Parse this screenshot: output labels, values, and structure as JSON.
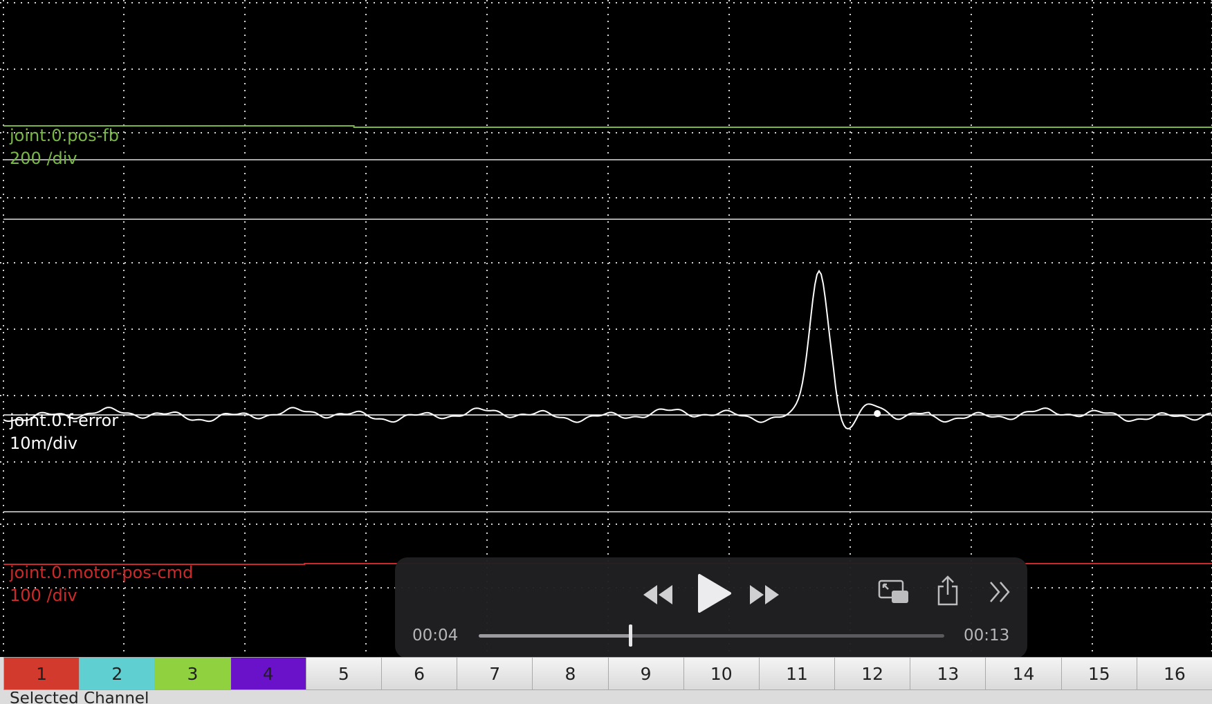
{
  "channels": [
    {
      "name": "joint.0.pos-fb",
      "scale": "200 /div",
      "color": "#7ab648"
    },
    {
      "name": "joint.0.f-error",
      "scale": "10m/div",
      "color": "#ffffff"
    },
    {
      "name": "joint.0.motor-pos-cmd",
      "scale": "100 /div",
      "color": "#cc2a2a"
    }
  ],
  "trace_shape": {
    "pos_fb_step_fraction": 0.29,
    "f_error_peak": {
      "time_fraction": 0.675,
      "amplitude_divs": 2.2
    },
    "f_error_ringing_divs": 0.45
  },
  "player": {
    "current_time": "00:04",
    "total_time": "00:13",
    "progress_fraction": 0.325,
    "icons": [
      "rewind-icon",
      "play-icon",
      "fast-forward-icon",
      "picture-in-picture-icon",
      "share-icon",
      "more-chevrons-icon"
    ]
  },
  "channel_buttons": [
    {
      "label": "1",
      "color": "#d23a2e"
    },
    {
      "label": "2",
      "color": "#5fcfd2"
    },
    {
      "label": "3",
      "color": "#8fd13f"
    },
    {
      "label": "4",
      "color": "#6a12c9"
    },
    {
      "label": "5",
      "color": ""
    },
    {
      "label": "6",
      "color": ""
    },
    {
      "label": "7",
      "color": ""
    },
    {
      "label": "8",
      "color": ""
    },
    {
      "label": "9",
      "color": ""
    },
    {
      "label": "10",
      "color": ""
    },
    {
      "label": "11",
      "color": ""
    },
    {
      "label": "12",
      "color": ""
    },
    {
      "label": "13",
      "color": ""
    },
    {
      "label": "14",
      "color": ""
    },
    {
      "label": "15",
      "color": ""
    },
    {
      "label": "16",
      "color": ""
    }
  ],
  "selected_channel_label": "Selected Channel"
}
